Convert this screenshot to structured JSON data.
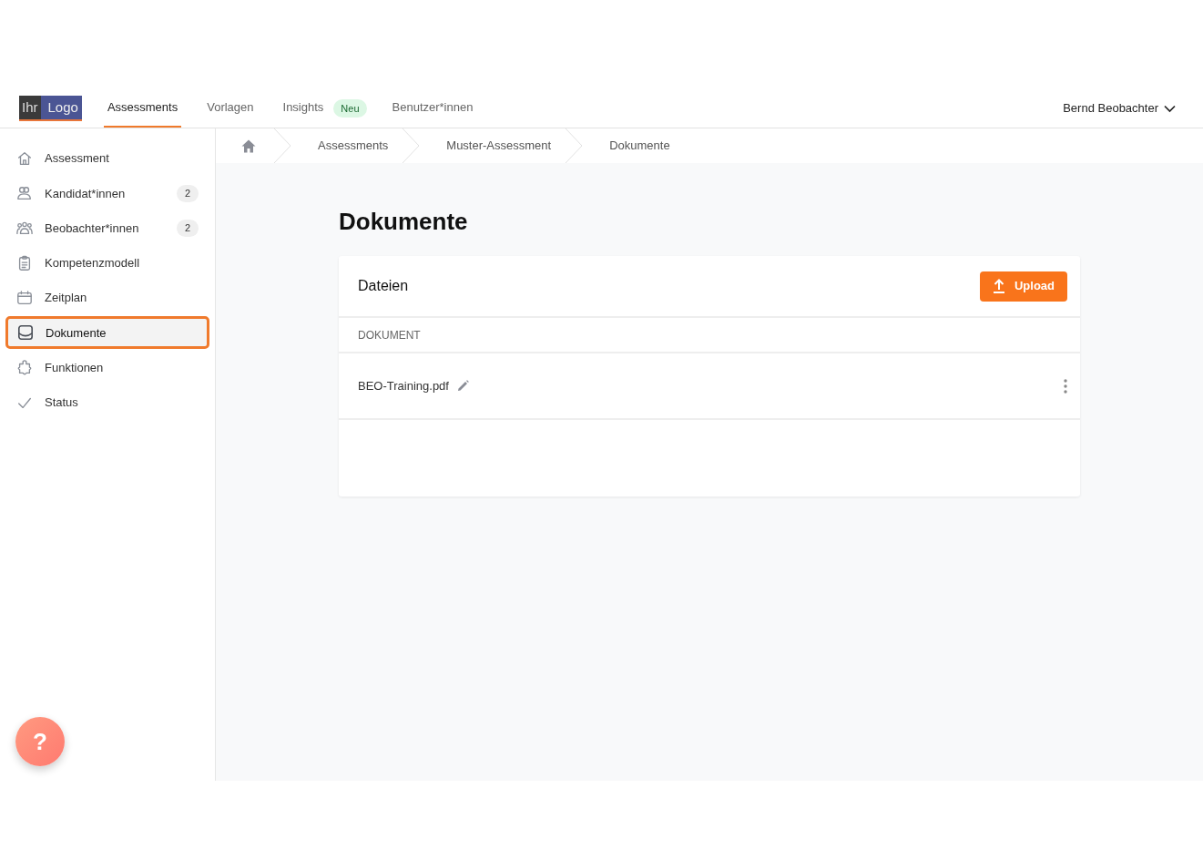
{
  "logo": {
    "part_1": "Ihr",
    "part_2": "Logo"
  },
  "nav": [
    {
      "label": "Assessments",
      "selected": true
    },
    {
      "label": "Vorlagen",
      "selected": false
    },
    {
      "label": "Insights",
      "selected": false,
      "badge": "Neu"
    },
    {
      "label": "Benutzer*innen",
      "selected": false
    }
  ],
  "user": {
    "name": "Bernd Beobachter"
  },
  "sidebar": {
    "items": [
      {
        "label": "Assessment",
        "selected": false
      },
      {
        "label": "Kandidat*innen",
        "selected": false,
        "count": "2"
      },
      {
        "label": "Beobachter*innen",
        "selected": false,
        "count": "2"
      },
      {
        "label": "Kompetenzmodell",
        "selected": false
      },
      {
        "label": "Zeitplan",
        "selected": false
      },
      {
        "label": "Dokumente",
        "selected": true
      },
      {
        "label": "Funktionen",
        "selected": false
      },
      {
        "label": "Status",
        "selected": false
      }
    ]
  },
  "breadcrumb": [
    "Assessments",
    "Muster-Assessment",
    "Dokumente"
  ],
  "page_title": "Dokumente",
  "card": {
    "title": "Dateien",
    "upload_label": "Upload",
    "column": "DOKUMENT",
    "rows": [
      {
        "name": "BEO-Training.pdf"
      }
    ]
  },
  "help_label": "?"
}
